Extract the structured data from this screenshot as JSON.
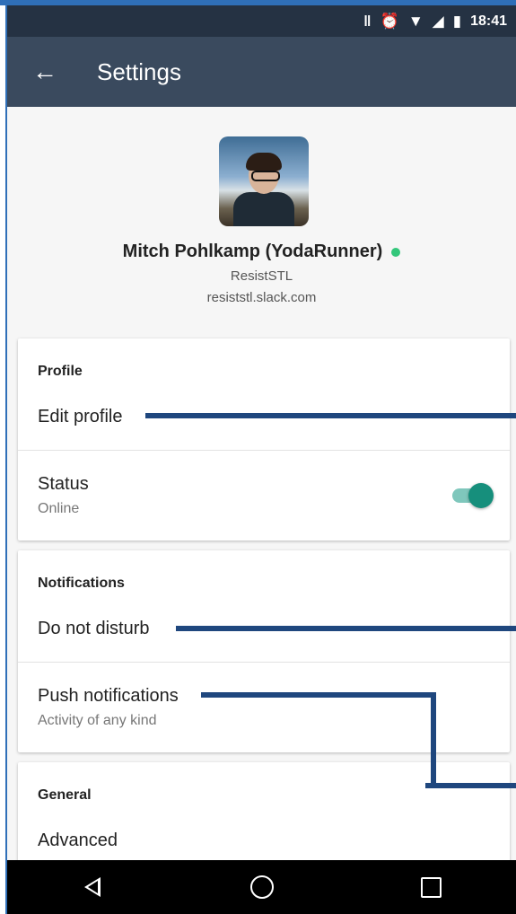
{
  "status_bar": {
    "icons": [
      "vibrate-icon",
      "alarm-icon",
      "wifi-icon",
      "signal-icon",
      "battery-icon"
    ],
    "time": "18:41"
  },
  "app_bar": {
    "title": "Settings"
  },
  "profile": {
    "name": "Mitch Pohlkamp (YodaRunner)",
    "team": "ResistSTL",
    "domain": "resiststl.slack.com",
    "presence_color": "#34c77b"
  },
  "sections": {
    "profile": {
      "header": "Profile",
      "edit_profile": "Edit profile",
      "status_title": "Status",
      "status_value": "Online",
      "status_toggle_on": true
    },
    "notifications": {
      "header": "Notifications",
      "dnd": "Do not disturb",
      "push_title": "Push notifications",
      "push_sub": "Activity of any kind"
    },
    "general": {
      "header": "General",
      "advanced": "Advanced"
    }
  },
  "colors": {
    "status_bar": "#253243",
    "app_bar": "#3a4a5e",
    "toggle_accent": "#168f7c",
    "annotation": "#1f477e"
  }
}
